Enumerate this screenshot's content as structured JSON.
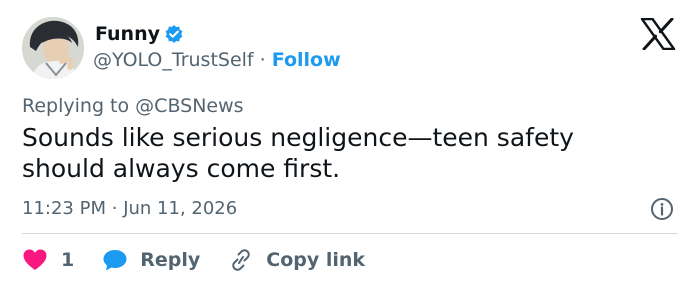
{
  "author": {
    "name": "Funny",
    "handle": "@YOLO_TrustSelf",
    "separator": "·",
    "follow_label": "Follow",
    "verified_color": "#1d9bf0"
  },
  "reply_context": {
    "prefix": "Replying to",
    "mention": "@CBSNews"
  },
  "tweet": {
    "text": "Sounds like serious negligence—teen safety should always come first.",
    "time": "11:23 PM",
    "separator": "·",
    "date": "Jun 11, 2026"
  },
  "actions": {
    "like_count": "1",
    "reply_label": "Reply",
    "copy_label": "Copy link"
  },
  "icons": {
    "logo": "x-logo-icon",
    "verified": "verified-badge-icon",
    "info": "info-icon",
    "like": "heart-icon",
    "reply": "reply-bubble-icon",
    "copy": "link-icon"
  },
  "colors": {
    "accent": "#1d9bf0",
    "like": "#f91880",
    "muted_text": "#536471",
    "text": "#0f1419",
    "divider": "#cfd9de"
  }
}
